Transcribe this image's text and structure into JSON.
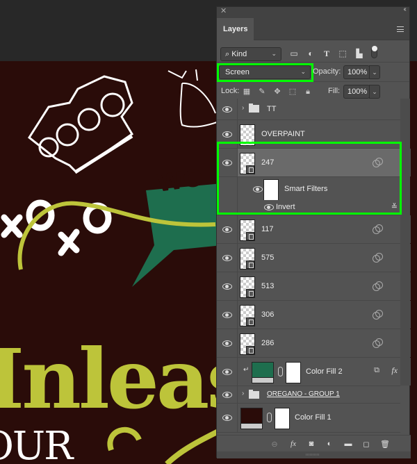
{
  "panel": {
    "tab": "Layers",
    "filter": {
      "kind_label": "Kind",
      "icons": [
        "image-filter-icon",
        "adjustment-filter-icon",
        "type-filter-icon",
        "shape-filter-icon",
        "smart-object-filter-icon"
      ]
    },
    "blend_mode": "Screen",
    "opacity_label": "Opacity:",
    "opacity_value": "100%",
    "lock_label": "Lock:",
    "fill_label": "Fill:",
    "fill_value": "100%",
    "layers": [
      {
        "name": "TT",
        "type": "group"
      },
      {
        "name": "OVERPAINT",
        "type": "pixel"
      },
      {
        "name": "247",
        "type": "smart-object",
        "selected": true
      },
      {
        "name": "Smart Filters",
        "type": "smart-filters"
      },
      {
        "name": "Invert",
        "type": "filter"
      },
      {
        "name": "117",
        "type": "smart-object"
      },
      {
        "name": "575",
        "type": "smart-object"
      },
      {
        "name": "513",
        "type": "smart-object"
      },
      {
        "name": "306",
        "type": "smart-object"
      },
      {
        "name": "286",
        "type": "smart-object"
      },
      {
        "name": "Color Fill 2",
        "type": "fill",
        "color": "#1e6e4e",
        "clipped": true,
        "fx": "fx"
      },
      {
        "name": "OREGANO - GROUP 1",
        "type": "group"
      },
      {
        "name": "Color Fill 1",
        "type": "fill",
        "color": "#2a0c09"
      }
    ]
  },
  "canvas": {
    "text_main": "Inleas",
    "text_sub": "OUR",
    "bubble_text": "WO",
    "colors": {
      "background": "#2a0c09",
      "lime": "#bdc43a",
      "green": "#1e6e4e"
    }
  }
}
